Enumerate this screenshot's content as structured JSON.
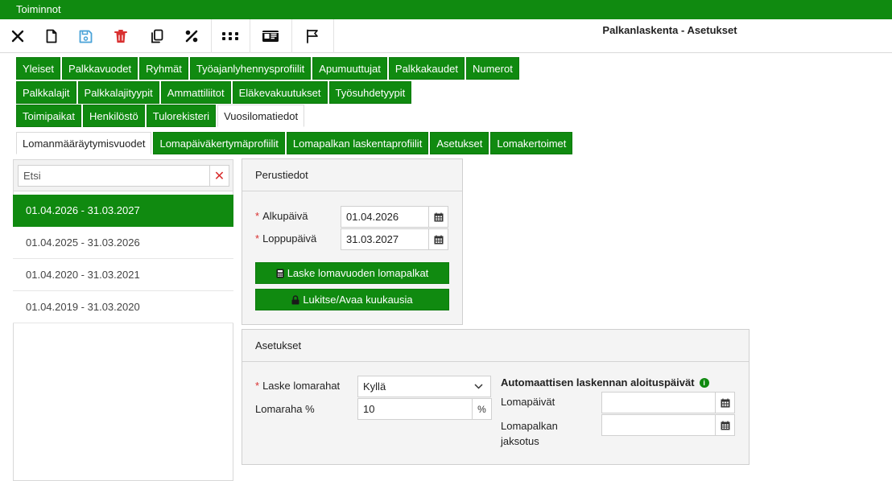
{
  "menubar": {
    "title": "Toiminnot"
  },
  "toolbar": {
    "page_title": "Palkanlaskenta - Asetukset",
    "icons": [
      "close-icon",
      "new-document-icon",
      "save-icon",
      "delete-icon",
      "copy-icon",
      "percent-icon",
      "grid-dots-icon",
      "id-card-icon",
      "flag-icon"
    ],
    "colors": {
      "save": "#4aa3d8",
      "delete": "#d93030"
    }
  },
  "tabs": {
    "row1": [
      "Yleiset",
      "Palkkavuodet",
      "Ryhmät",
      "Työajanlyhennysprofiilit",
      "Apumuuttujat",
      "Palkkakaudet",
      "Numerot"
    ],
    "row2": [
      "Palkkalajit",
      "Palkkalajityypit",
      "Ammattiliitot",
      "Eläkevakuutukset",
      "Työsuhdetyypit"
    ],
    "row3": [
      "Toimipaikat",
      "Henkilöstö",
      "Tulorekisteri",
      "Vuosilomatiedot"
    ],
    "row4": [
      "Lomanmääräytymisvuodet",
      "Lomapäiväkertymäprofiilit",
      "Lomapalkan laskentaprofiilit",
      "Asetukset",
      "Lomakertoimet"
    ],
    "active_row3": "Vuosilomatiedot",
    "active_row4": "Lomanmääräytymisvuodet"
  },
  "search": {
    "placeholder": "Etsi",
    "clear_symbol": "✕"
  },
  "periods": [
    {
      "label": "01.04.2026 - 31.03.2027",
      "selected": true
    },
    {
      "label": "01.04.2025 - 31.03.2026",
      "selected": false
    },
    {
      "label": "01.04.2020 - 31.03.2021",
      "selected": false
    },
    {
      "label": "01.04.2019 - 31.03.2020",
      "selected": false
    }
  ],
  "basic": {
    "title": "Perustiedot",
    "start_label": "Alkupäivä",
    "start_value": "01.04.2026",
    "end_label": "Loppupäivä",
    "end_value": "31.03.2027",
    "calc_button": "Laske lomavuoden lomapalkat",
    "lock_button": "Lukitse/Avaa kuukausia"
  },
  "settings": {
    "title": "Asetukset",
    "calc_label": "Laske lomarahat",
    "calc_value": "Kyllä",
    "pct_label": "Lomaraha %",
    "pct_value": "10",
    "pct_unit": "%",
    "auto_title": "Automaattisen laskennan aloituspäivät",
    "info_symbol": "i",
    "holidays_label": "Lomapäivät",
    "holidays_value": "",
    "pay_label": "Lomapalkan jaksotus",
    "pay_value": ""
  },
  "colors": {
    "accent": "#108a10",
    "required": "#d93030"
  }
}
